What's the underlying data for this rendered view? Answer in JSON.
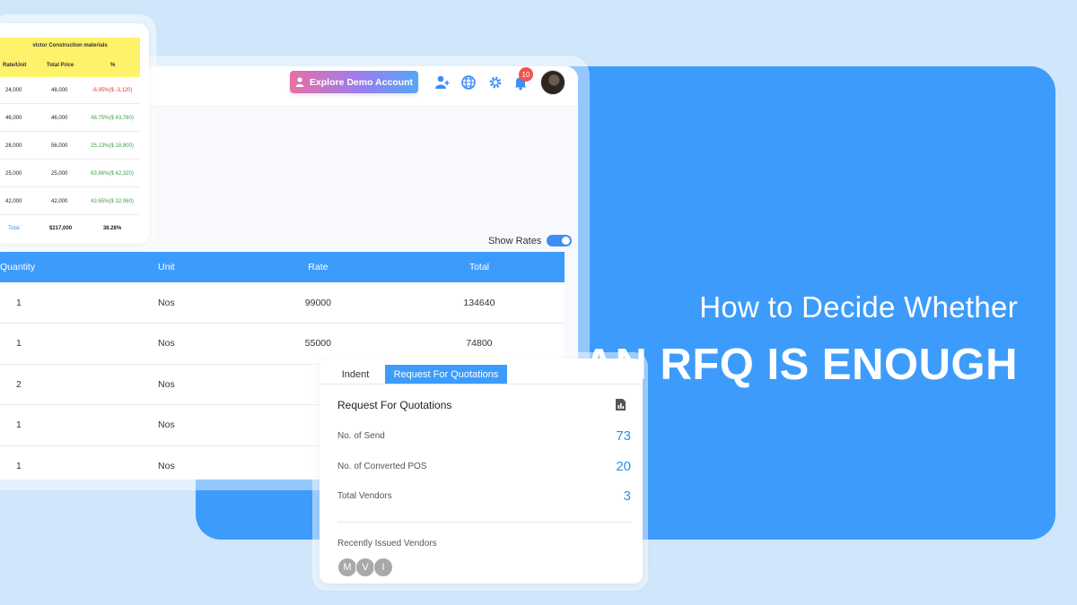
{
  "banner": {
    "line1": "How to Decide Whether",
    "line2": "AN RFQ IS ENOUGH",
    "color": "#3d9cfb"
  },
  "topbar": {
    "demo_button": "Explore Demo Account",
    "notification_count": "10",
    "icons": [
      "add-user-icon",
      "globe-icon",
      "gear-icon",
      "bell-icon"
    ]
  },
  "show_rates": {
    "label": "Show Rates",
    "enabled": true
  },
  "items_table": {
    "headers": [
      "Quantity",
      "Unit",
      "Rate",
      "Total"
    ],
    "rows": [
      [
        "1",
        "Nos",
        "99000",
        "134640"
      ],
      [
        "1",
        "Nos",
        "55000",
        "74800"
      ],
      [
        "2",
        "Nos",
        "",
        ""
      ],
      [
        "1",
        "Nos",
        "",
        ""
      ],
      [
        "1",
        "Nos",
        "",
        ""
      ]
    ]
  },
  "comparison": {
    "title": "victor Construction materials",
    "headers": [
      "Rate/Unit",
      "Total Price",
      "%"
    ],
    "rows": [
      [
        "24,000",
        "48,000",
        "-6.95%($ -3,120)"
      ],
      [
        "46,000",
        "46,000",
        "48.75%($ 43,760)"
      ],
      [
        "28,000",
        "56,000",
        "25.13%($ 18,800)"
      ],
      [
        "25,000",
        "25,000",
        "63.86%($ 42,320)"
      ],
      [
        "42,000",
        "42,000",
        "43.65%($ 32,060)"
      ]
    ],
    "total": [
      "Total",
      "$217,000",
      "38.28%"
    ]
  },
  "rfq": {
    "tabs": [
      "Indent",
      "Request For Quotations"
    ],
    "active_tab": "Request For Quotations",
    "heading": "Request For Quotations",
    "stats": [
      {
        "label": "No. of Send",
        "value": "73"
      },
      {
        "label": "No. of Converted POS",
        "value": "20"
      },
      {
        "label": "Total Vendors",
        "value": "3"
      }
    ],
    "recent_label": "Recently Issued Vendors",
    "vendors": [
      "M",
      "V",
      "I"
    ]
  }
}
